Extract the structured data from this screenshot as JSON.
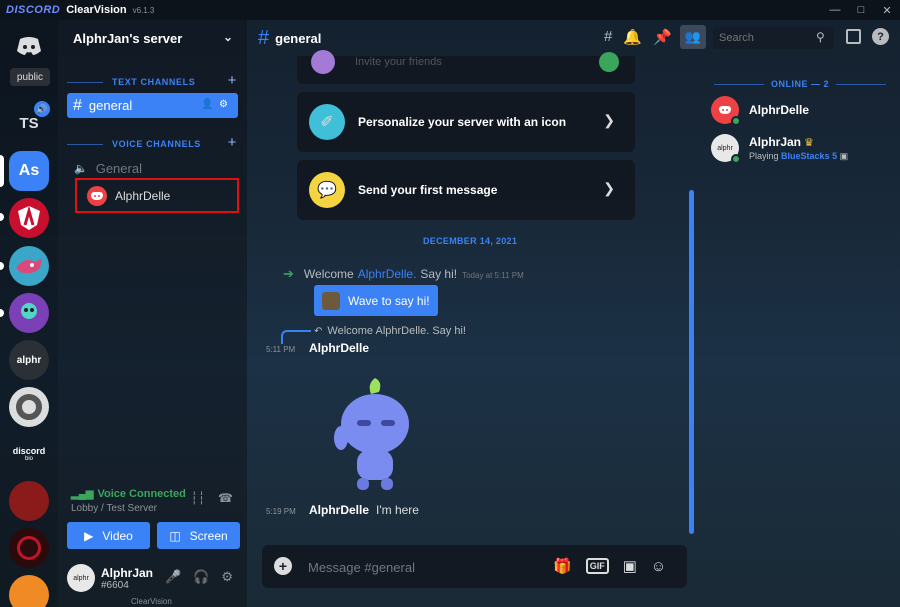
{
  "titlebar": {
    "brand": "DISCORD",
    "theme": "ClearVision",
    "version": "v6.1.3",
    "buttons": [
      "minimize-icon",
      "maximize-icon",
      "close-icon"
    ]
  },
  "guilds": {
    "tooltip": "public",
    "ts_label": "TS",
    "selected_label": "As",
    "alphr_label": "alphr",
    "discord_bio_label": "discord",
    "discord_bio_sub": "bio",
    "accent": "#3b82f6"
  },
  "sidebar": {
    "server_name": "AlphrJan's server",
    "text_category": "TEXT CHANNELS",
    "voice_category": "VOICE CHANNELS",
    "text_channel": "general",
    "voice_channel": "General",
    "voice_user": "AlphrDelle"
  },
  "voice_panel": {
    "status": "Voice Connected",
    "subtitle": "Lobby / Test Server",
    "video_label": "Video",
    "screen_label": "Screen"
  },
  "user_panel": {
    "name": "AlphrJan",
    "tag": "#6604",
    "avatar_text": "alphr",
    "watermark": "ClearVision"
  },
  "chat_header": {
    "channel": "general",
    "search_placeholder": "Search"
  },
  "cards": {
    "top_faded": "Invite your friends",
    "personalize": "Personalize your server with an icon",
    "first_message": "Send your first message"
  },
  "messages": {
    "date_divider": "DECEMBER 14, 2021",
    "welcome_prefix": "Welcome",
    "welcome_user": "AlphrDelle.",
    "welcome_suffix": "Say hi!",
    "welcome_time": "Today at 5:11 PM",
    "wave_button": "Wave to say hi!",
    "reply_ref": "Welcome AlphrDelle. Say hi!",
    "msg1_time": "5:11 PM",
    "msg1_author": "AlphrDelle",
    "msg2_time": "5:19 PM",
    "msg2_author": "AlphrDelle",
    "msg2_content": "I'm here"
  },
  "composer": {
    "placeholder": "Message #general",
    "gif_label": "GIF"
  },
  "members": {
    "online_header": "ONLINE — 2",
    "list": [
      {
        "name": "AlphrDelle",
        "activity_prefix": "",
        "activity_game": ""
      },
      {
        "name": "AlphrJan",
        "activity_prefix": "Playing",
        "activity_game": "BlueStacks 5"
      }
    ],
    "status_online": "#3ba55c"
  }
}
